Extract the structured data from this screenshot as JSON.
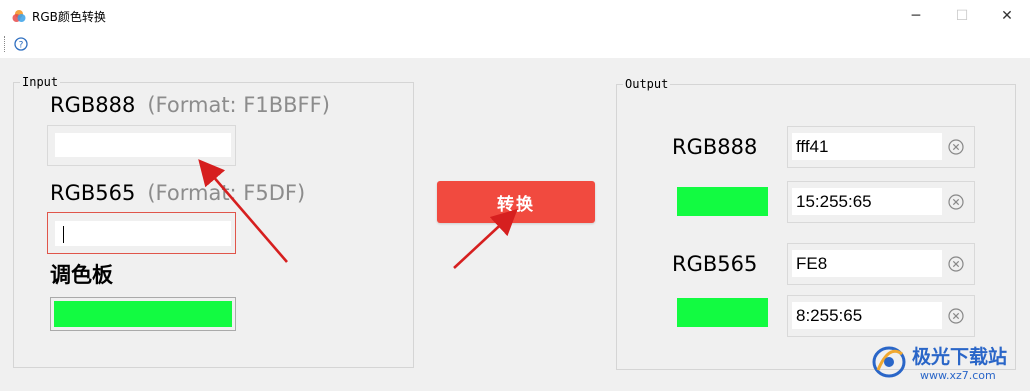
{
  "window": {
    "title": "RGB颜色转换",
    "minimize_glyph": "─",
    "maximize_glyph": "☐",
    "close_glyph": "✕"
  },
  "input": {
    "legend": "Input",
    "rgb888_label": "RGB888",
    "rgb888_hint": "(Format:  F1BBFF)",
    "rgb888_value": "",
    "rgb565_label": "RGB565",
    "rgb565_hint": "(Format:  F5DF)",
    "rgb565_value": "",
    "palette_label": "调色板",
    "palette_color": "#12fb41"
  },
  "convert_button": "转换",
  "output": {
    "legend": "Output",
    "rgb888_label": "RGB888",
    "rgb888_hex": "fff41",
    "rgb888_dec": "15:255:65",
    "rgb565_label": "RGB565",
    "rgb565_hex": "FE8",
    "rgb565_dec": "8:255:65",
    "swatch_color": "#12fb41"
  },
  "watermark": {
    "name": "极光下载站",
    "url": "www.xz7.com"
  },
  "colors": {
    "accent": "#f14a3f",
    "arrow": "#d61f1f",
    "swatch_green": "#12fb41"
  }
}
